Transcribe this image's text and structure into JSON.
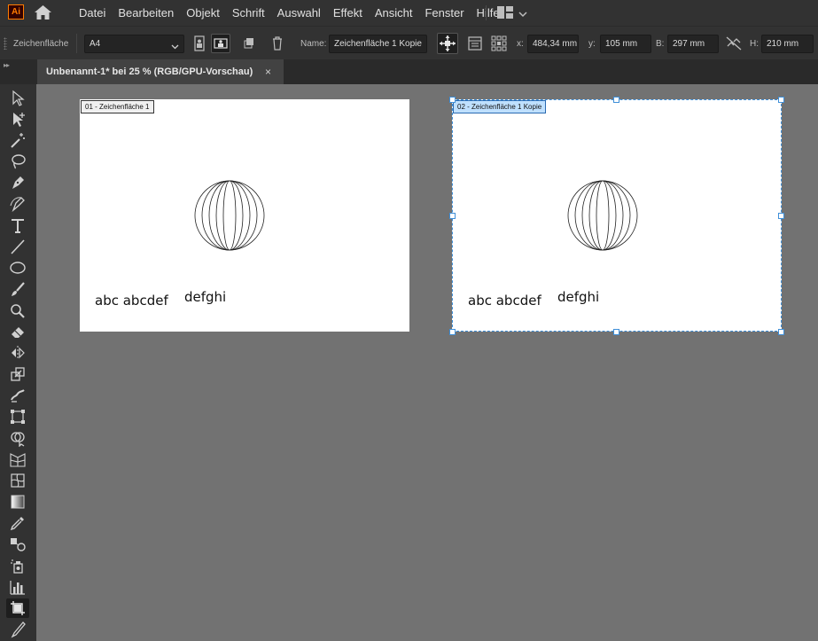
{
  "app": {
    "logo_text": "Ai",
    "menu": [
      "Datei",
      "Bearbeiten",
      "Objekt",
      "Schrift",
      "Auswahl",
      "Effekt",
      "Ansicht",
      "Fenster",
      "Hilfe"
    ]
  },
  "control": {
    "mode_label": "Zeichenfläche",
    "preset_value": "A4",
    "name_label": "Name:",
    "name_value": "Zeichenfläche 1 Kopie",
    "x_label": "x:",
    "x_value": "484,34 mm",
    "y_label": "y:",
    "y_value": "105 mm",
    "w_label": "B:",
    "w_value": "297 mm",
    "h_label": "H:",
    "h_value": "210 mm"
  },
  "document": {
    "tab_title": "Unbenannt-1* bei 25 % (RGB/GPU-Vorschau)",
    "close_glyph": "×"
  },
  "artboards": [
    {
      "label": "01 - Zeichenfläche 1",
      "text_1": "abc abcdef",
      "text_2": "defghi",
      "selected": false
    },
    {
      "label": "02 - Zeichenfläche 1 Kopie",
      "text_1": "abc abcdef",
      "text_2": "defghi",
      "selected": true
    }
  ],
  "tools": [
    "selection-tool",
    "direct-selection-tool",
    "magic-wand-tool",
    "lasso-tool",
    "pen-tool",
    "curvature-tool",
    "type-tool",
    "line-segment-tool",
    "ellipse-tool",
    "paintbrush-tool",
    "blob-brush-tool",
    "eraser-tool",
    "reflect-tool",
    "scale-tool",
    "warp-tool",
    "free-transform-tool",
    "shape-builder-tool",
    "perspective-grid-tool",
    "mesh-tool",
    "gradient-tool",
    "eyedropper-tool",
    "blend-tool",
    "symbol-sprayer-tool",
    "column-graph-tool",
    "artboard-tool",
    "slice-tool"
  ],
  "colors": {
    "selection": "#3f8fd8",
    "logo_orange": "#ff7c00",
    "canvas": "#727272",
    "chrome": "#323232"
  }
}
